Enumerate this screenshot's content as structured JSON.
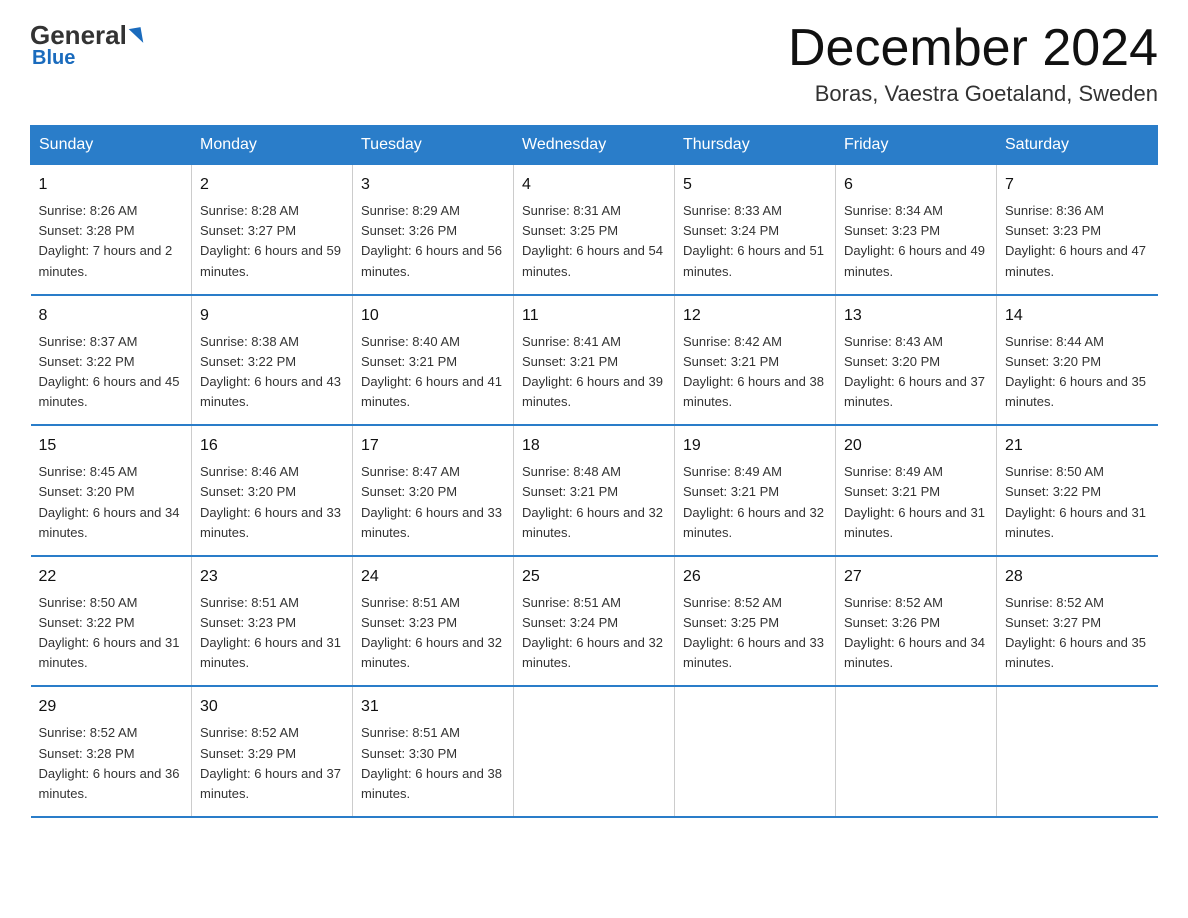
{
  "logo": {
    "general": "General",
    "blue": "Blue",
    "underline": "Blue"
  },
  "header": {
    "month": "December 2024",
    "location": "Boras, Vaestra Goetaland, Sweden"
  },
  "weekdays": [
    "Sunday",
    "Monday",
    "Tuesday",
    "Wednesday",
    "Thursday",
    "Friday",
    "Saturday"
  ],
  "weeks": [
    [
      {
        "day": "1",
        "sunrise": "8:26 AM",
        "sunset": "3:28 PM",
        "daylight": "7 hours and 2 minutes"
      },
      {
        "day": "2",
        "sunrise": "8:28 AM",
        "sunset": "3:27 PM",
        "daylight": "6 hours and 59 minutes"
      },
      {
        "day": "3",
        "sunrise": "8:29 AM",
        "sunset": "3:26 PM",
        "daylight": "6 hours and 56 minutes"
      },
      {
        "day": "4",
        "sunrise": "8:31 AM",
        "sunset": "3:25 PM",
        "daylight": "6 hours and 54 minutes"
      },
      {
        "day": "5",
        "sunrise": "8:33 AM",
        "sunset": "3:24 PM",
        "daylight": "6 hours and 51 minutes"
      },
      {
        "day": "6",
        "sunrise": "8:34 AM",
        "sunset": "3:23 PM",
        "daylight": "6 hours and 49 minutes"
      },
      {
        "day": "7",
        "sunrise": "8:36 AM",
        "sunset": "3:23 PM",
        "daylight": "6 hours and 47 minutes"
      }
    ],
    [
      {
        "day": "8",
        "sunrise": "8:37 AM",
        "sunset": "3:22 PM",
        "daylight": "6 hours and 45 minutes"
      },
      {
        "day": "9",
        "sunrise": "8:38 AM",
        "sunset": "3:22 PM",
        "daylight": "6 hours and 43 minutes"
      },
      {
        "day": "10",
        "sunrise": "8:40 AM",
        "sunset": "3:21 PM",
        "daylight": "6 hours and 41 minutes"
      },
      {
        "day": "11",
        "sunrise": "8:41 AM",
        "sunset": "3:21 PM",
        "daylight": "6 hours and 39 minutes"
      },
      {
        "day": "12",
        "sunrise": "8:42 AM",
        "sunset": "3:21 PM",
        "daylight": "6 hours and 38 minutes"
      },
      {
        "day": "13",
        "sunrise": "8:43 AM",
        "sunset": "3:20 PM",
        "daylight": "6 hours and 37 minutes"
      },
      {
        "day": "14",
        "sunrise": "8:44 AM",
        "sunset": "3:20 PM",
        "daylight": "6 hours and 35 minutes"
      }
    ],
    [
      {
        "day": "15",
        "sunrise": "8:45 AM",
        "sunset": "3:20 PM",
        "daylight": "6 hours and 34 minutes"
      },
      {
        "day": "16",
        "sunrise": "8:46 AM",
        "sunset": "3:20 PM",
        "daylight": "6 hours and 33 minutes"
      },
      {
        "day": "17",
        "sunrise": "8:47 AM",
        "sunset": "3:20 PM",
        "daylight": "6 hours and 33 minutes"
      },
      {
        "day": "18",
        "sunrise": "8:48 AM",
        "sunset": "3:21 PM",
        "daylight": "6 hours and 32 minutes"
      },
      {
        "day": "19",
        "sunrise": "8:49 AM",
        "sunset": "3:21 PM",
        "daylight": "6 hours and 32 minutes"
      },
      {
        "day": "20",
        "sunrise": "8:49 AM",
        "sunset": "3:21 PM",
        "daylight": "6 hours and 31 minutes"
      },
      {
        "day": "21",
        "sunrise": "8:50 AM",
        "sunset": "3:22 PM",
        "daylight": "6 hours and 31 minutes"
      }
    ],
    [
      {
        "day": "22",
        "sunrise": "8:50 AM",
        "sunset": "3:22 PM",
        "daylight": "6 hours and 31 minutes"
      },
      {
        "day": "23",
        "sunrise": "8:51 AM",
        "sunset": "3:23 PM",
        "daylight": "6 hours and 31 minutes"
      },
      {
        "day": "24",
        "sunrise": "8:51 AM",
        "sunset": "3:23 PM",
        "daylight": "6 hours and 32 minutes"
      },
      {
        "day": "25",
        "sunrise": "8:51 AM",
        "sunset": "3:24 PM",
        "daylight": "6 hours and 32 minutes"
      },
      {
        "day": "26",
        "sunrise": "8:52 AM",
        "sunset": "3:25 PM",
        "daylight": "6 hours and 33 minutes"
      },
      {
        "day": "27",
        "sunrise": "8:52 AM",
        "sunset": "3:26 PM",
        "daylight": "6 hours and 34 minutes"
      },
      {
        "day": "28",
        "sunrise": "8:52 AM",
        "sunset": "3:27 PM",
        "daylight": "6 hours and 35 minutes"
      }
    ],
    [
      {
        "day": "29",
        "sunrise": "8:52 AM",
        "sunset": "3:28 PM",
        "daylight": "6 hours and 36 minutes"
      },
      {
        "day": "30",
        "sunrise": "8:52 AM",
        "sunset": "3:29 PM",
        "daylight": "6 hours and 37 minutes"
      },
      {
        "day": "31",
        "sunrise": "8:51 AM",
        "sunset": "3:30 PM",
        "daylight": "6 hours and 38 minutes"
      },
      null,
      null,
      null,
      null
    ]
  ]
}
